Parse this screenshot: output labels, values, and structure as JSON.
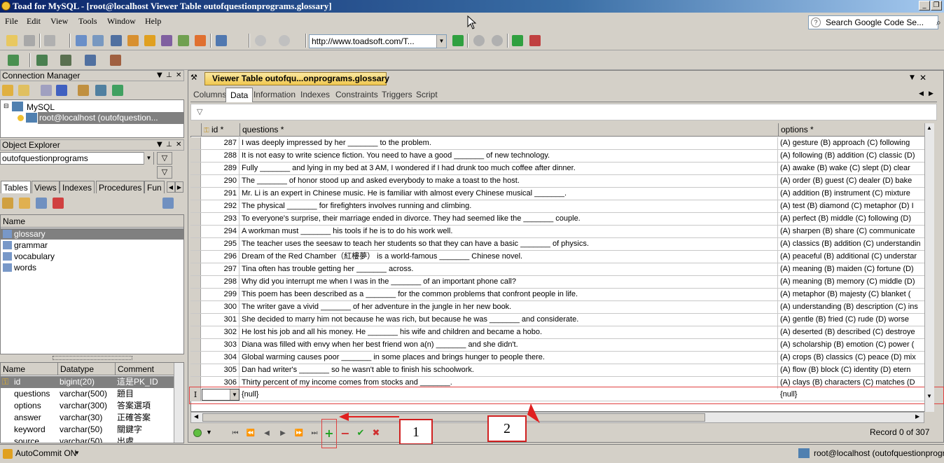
{
  "window": {
    "title": "Toad for MySQL - [root@localhost Viewer Table outofquestionprograms.glossary]"
  },
  "menu": [
    "File",
    "Edit",
    "View",
    "Tools",
    "Window",
    "Help"
  ],
  "google_search": {
    "placeholder": "Search Google Code Se..."
  },
  "toolbar": {
    "url": "http://www.toadsoft.com/T..."
  },
  "connection_manager": {
    "title": "Connection Manager",
    "tree": [
      {
        "label": "MySQL"
      },
      {
        "label": "root@localhost (outofquestion..."
      }
    ]
  },
  "object_explorer": {
    "title": "Object Explorer",
    "database": "outofquestionprograms",
    "tabs": [
      "Tables",
      "Views",
      "Indexes",
      "Procedures",
      "Fun"
    ],
    "list_header": "Name",
    "tables": [
      "glossary",
      "grammar",
      "vocabulary",
      "words"
    ],
    "selected_table": "glossary"
  },
  "columns_panel": {
    "headers": [
      "Name",
      "Datatype",
      "Comment"
    ],
    "rows": [
      {
        "name": "id",
        "type": "bigint(20)",
        "comment": "這是PK_ID"
      },
      {
        "name": "questions",
        "type": "varchar(500)",
        "comment": "題目"
      },
      {
        "name": "options",
        "type": "varchar(300)",
        "comment": "答案選項"
      },
      {
        "name": "answer",
        "type": "varchar(30)",
        "comment": "正確答案"
      },
      {
        "name": "keyword",
        "type": "varchar(50)",
        "comment": "關鍵字"
      },
      {
        "name": "source",
        "type": "varchar(50)",
        "comment": "出處"
      }
    ]
  },
  "viewer": {
    "tab_title": "Viewer Table outofqu...onprograms.glossary",
    "subtabs": [
      "Columns",
      "Data",
      "Information",
      "Indexes",
      "Constraints",
      "Triggers",
      "Script"
    ],
    "active_subtab": "Data",
    "headers": {
      "id": "id *",
      "questions": "questions *",
      "options": "options *"
    },
    "rows": [
      {
        "id": "287",
        "q": "I was deeply impressed by her _______ to the problem.",
        "o": "(A) gesture   (B) approach   (C) following"
      },
      {
        "id": "288",
        "q": "It is not easy to write science fiction. You need to have a good _______ of new technology.",
        "o": "(A) following   (B) addition   (C) classic   (D)"
      },
      {
        "id": "289",
        "q": "Fully _______ and lying in my bed at 3 AM, I wondered if I had drunk too much coffee after dinner.",
        "o": "(A) awake   (B) wake   (C) slept   (D) clear"
      },
      {
        "id": "290",
        "q": "The _______ of honor stood up and asked everybody to make a toast to the host.",
        "o": "(A) order   (B) guest   (C) dealer   (D) bake"
      },
      {
        "id": "291",
        "q": "Mr. Li is an expert in Chinese music. He is familiar with almost every Chinese musical _______.",
        "o": "(A) addition   (B) instrument   (C) mixture"
      },
      {
        "id": "292",
        "q": "The physical _______ for firefighters involves running and climbing.",
        "o": "(A) test   (B) diamond   (C) metaphor   (D) I"
      },
      {
        "id": "293",
        "q": "To everyone's surprise, their marriage ended in divorce. They had seemed like the _______ couple.",
        "o": "(A) perfect   (B) middle   (C) following   (D)"
      },
      {
        "id": "294",
        "q": "A workman must _______ his tools if he is to do his work well.",
        "o": "(A) sharpen   (B) share   (C) communicate"
      },
      {
        "id": "295",
        "q": "The teacher uses the seesaw to teach her students so that they can have a basic _______ of physics.",
        "o": "(A) classics   (B) addition   (C) understandin"
      },
      {
        "id": "296",
        "q": "Dream of the Red Chamber（紅樓夢） is a world-famous _______ Chinese novel.",
        "o": "(A) peaceful   (B) additional   (C) understar"
      },
      {
        "id": "297",
        "q": "Tina often has trouble getting her _______ across.",
        "o": "(A) meaning   (B) maiden   (C) fortune   (D)"
      },
      {
        "id": "298",
        "q": "Why did you interrupt me when I was in the _______ of an important phone call?",
        "o": "(A) meaning   (B) memory   (C) middle   (D)"
      },
      {
        "id": "299",
        "q": "This poem has been described as a _______ for the common problems that confront people in life.",
        "o": "(A) metaphor   (B) majesty   (C) blanket   ("
      },
      {
        "id": "300",
        "q": "The writer gave a vivid _______ of her adventure in the jungle in her new book.",
        "o": "(A) understanding   (B) description   (C) ins"
      },
      {
        "id": "301",
        "q": "She decided to marry him not because he was rich, but because he was _______ and considerate.",
        "o": "(A) gentle   (B) fried   (C) rude   (D) worse"
      },
      {
        "id": "302",
        "q": "He lost his job and all his money. He _______ his wife and children and became a hobo.",
        "o": "(A) deserted   (B) described   (C) destroye"
      },
      {
        "id": "303",
        "q": "Diana was filled with envy when her best friend won a(n) _______ and she didn't.",
        "o": "(A) scholarship   (B) emotion   (C) power   ("
      },
      {
        "id": "304",
        "q": "Global warming causes poor _______ in some places and brings hunger to people there.",
        "o": "(A) crops   (B) classics   (C) peace   (D) mix"
      },
      {
        "id": "305",
        "q": "Dan had writer's _______ so he wasn't able to finish his schoolwork.",
        "o": "(A) flow   (B) block   (C) identity   (D) etern"
      },
      {
        "id": "306",
        "q": "Thirty percent of my income comes from stocks and _______.",
        "o": "(A) clays   (B) characters   (C) matches   (D"
      }
    ],
    "new_row": {
      "q": "{null}",
      "o": "{null}"
    },
    "record_status": "Record 0 of 307"
  },
  "annotations": {
    "callout1": "1",
    "callout2": "2"
  },
  "statusbar": {
    "autocommit": "AutoCommit ON",
    "connection": "root@localhost (outofquestionprograms"
  }
}
